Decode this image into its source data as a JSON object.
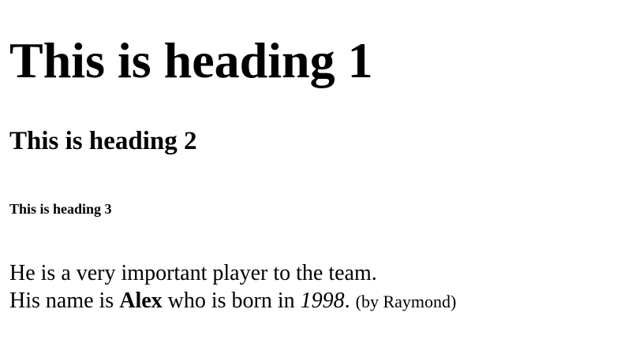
{
  "headings": {
    "h1": "This is heading 1",
    "h2": "This is heading 2",
    "h3": "This is heading 3"
  },
  "paragraph": {
    "line1": "He is a very important player to the team.",
    "line2_prefix": "His name is ",
    "name": "Alex",
    "line2_middle": " who is born in ",
    "year": "1998",
    "line2_period": ". ",
    "credit": "(by Raymond)"
  }
}
